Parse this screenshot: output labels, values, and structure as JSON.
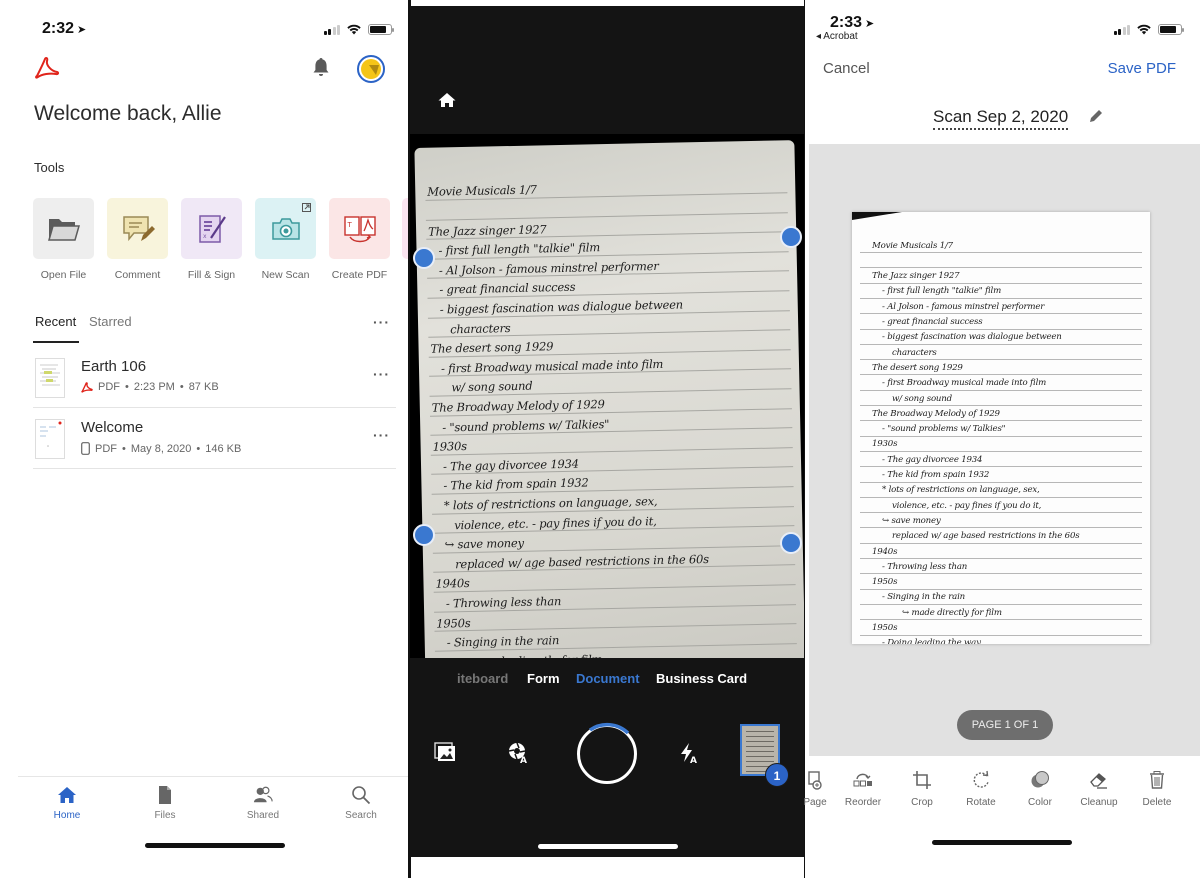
{
  "home_screen": {
    "status_bar": {
      "time": "2:32"
    },
    "greeting": "Welcome back, Allie",
    "tools_heading": "Tools",
    "tools": [
      {
        "label": "Open File",
        "icon": "folder-icon",
        "color": "#eeeeee"
      },
      {
        "label": "Comment",
        "icon": "comment-icon",
        "color": "#f8f4dc"
      },
      {
        "label": "Fill & Sign",
        "icon": "fill-sign-icon",
        "color": "#f0e8f6"
      },
      {
        "label": "New Scan",
        "icon": "camera-icon",
        "color": "#dcf2f4"
      },
      {
        "label": "Create PDF",
        "icon": "create-pdf-icon",
        "color": "#fbe6e6"
      }
    ],
    "tabs": [
      {
        "label": "Recent",
        "active": true
      },
      {
        "label": "Starred",
        "active": false
      }
    ],
    "files": [
      {
        "name": "Earth 106",
        "type": "PDF",
        "date": "2:23 PM",
        "size": "87 KB",
        "source_icon": "acrobat-icon"
      },
      {
        "name": "Welcome",
        "type": "PDF",
        "date": "May 8, 2020",
        "size": "146 KB",
        "source_icon": "phone-icon"
      }
    ],
    "meta_separator": "•",
    "bottom_nav": [
      {
        "label": "Home",
        "icon": "home-icon",
        "active": true
      },
      {
        "label": "Files",
        "icon": "file-icon",
        "active": false
      },
      {
        "label": "Shared",
        "icon": "shared-users-icon",
        "active": false
      },
      {
        "label": "Search",
        "icon": "search-icon",
        "active": false
      }
    ]
  },
  "camera_screen": {
    "modes": [
      {
        "label": "iteboard",
        "state": "dim"
      },
      {
        "label": "Form",
        "state": "normal"
      },
      {
        "label": "Document",
        "state": "active"
      },
      {
        "label": "Business Card",
        "state": "normal"
      }
    ],
    "captured_count": "1",
    "controls": [
      "gallery-icon",
      "auto-capture-icon",
      "shutter-button",
      "flash-auto-icon",
      "thumbnail-stack"
    ]
  },
  "note_text": {
    "lines": [
      "Movie Musicals 1/7",
      "",
      "The Jazz singer 1927",
      "  - first full length \"talkie\" film",
      "  - Al Jolson - famous minstrel performer",
      "  - great financial success",
      "  - biggest fascination was dialogue between",
      "    characters",
      "The desert song 1929",
      "  - first Broadway musical made into film",
      "    w/ song sound",
      "The Broadway Melody of 1929",
      "  - \"sound problems w/ Talkies\"",
      "1930s",
      "  - The gay divorcee 1934",
      "  - The kid from spain 1932",
      "  * lots of restrictions on language, sex,",
      "    violence, etc. - pay fines if you do it,",
      "  ↪ save money",
      "    replaced w/ age based restrictions in the 60s",
      "1940s",
      "  - Throwing less than",
      "1950s",
      "  - Singing in the rain",
      "      ↪ made directly for film",
      "1950s",
      "  - Doing leading the way"
    ]
  },
  "review_screen": {
    "status_bar": {
      "time": "2:33",
      "back_app": "◂ Acrobat"
    },
    "cancel_label": "Cancel",
    "save_label": "Save PDF",
    "doc_title": "Scan Sep 2, 2020",
    "page_indicator": "PAGE 1 OF 1",
    "edit_tools": [
      {
        "label": "Page",
        "icon": "add-page-icon"
      },
      {
        "label": "Reorder",
        "icon": "reorder-icon"
      },
      {
        "label": "Crop",
        "icon": "crop-icon"
      },
      {
        "label": "Rotate",
        "icon": "rotate-icon"
      },
      {
        "label": "Color",
        "icon": "color-icon"
      },
      {
        "label": "Cleanup",
        "icon": "eraser-icon"
      },
      {
        "label": "Delete",
        "icon": "trash-icon"
      }
    ]
  },
  "colors": {
    "accent_blue": "#2b63c6",
    "acrobat_red": "#e0241b",
    "camera_bg": "#141414",
    "review_bg": "#e1e1e1"
  }
}
